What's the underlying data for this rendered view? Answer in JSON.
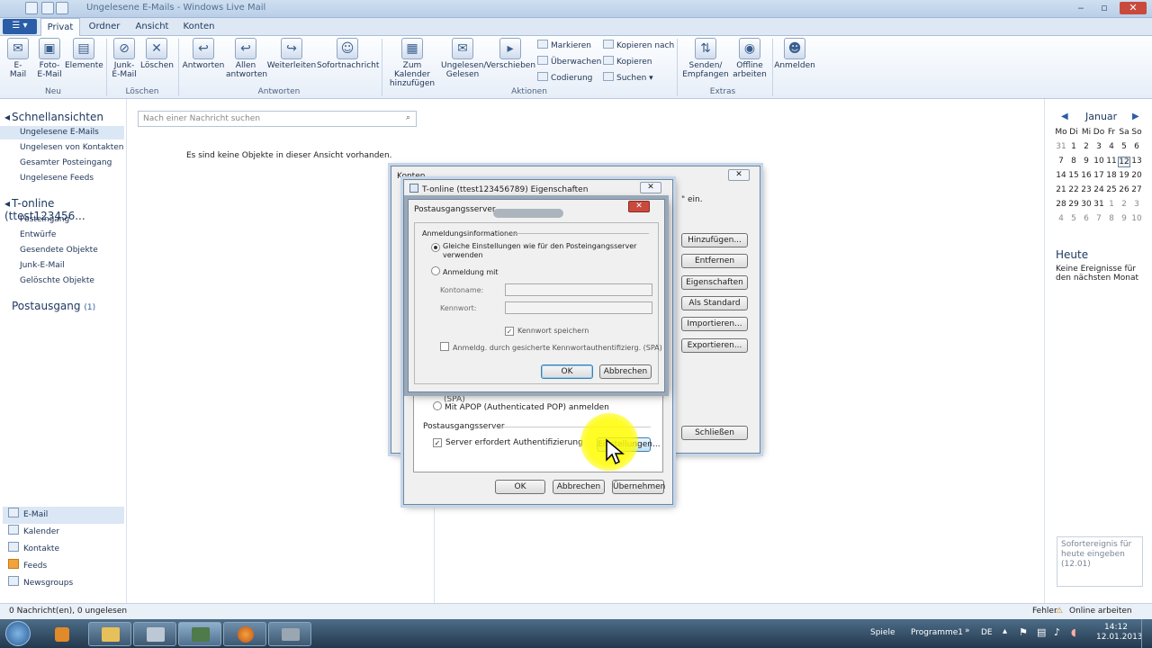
{
  "window": {
    "title": "Ungelesene E-Mails - Windows Live Mail"
  },
  "tabs": {
    "file": "☰ ▾",
    "items": [
      "Privat",
      "Ordner",
      "Ansicht",
      "Konten"
    ]
  },
  "ribbon": {
    "new": {
      "email": "E-Mail",
      "photo": "Foto-E-Mail",
      "items": "Elemente",
      "group": "Neu"
    },
    "delete": {
      "junk": "Junk-E-Mail",
      "delete": "Löschen",
      "group": "Löschen"
    },
    "respond": {
      "reply": "Antworten",
      "reply_all": "Allen antworten",
      "forward": "Weiterleiten",
      "im": "Sofortnachricht",
      "group": "Antworten"
    },
    "actions": {
      "calendar": "Zum Kalender hinzufügen",
      "unread": "Ungelesen/ Gelesen",
      "move": "Verschieben",
      "flag": "Markieren",
      "watch": "Überwachen",
      "encoding": "Codierung",
      "copy_to": "Kopieren nach",
      "copy": "Kopieren",
      "find": "Suchen",
      "group": "Aktionen"
    },
    "tools": {
      "sendrecv": "Senden/ Empfangen",
      "offline": "Offline arbeiten",
      "signin": "Anmelden",
      "group": "Extras"
    }
  },
  "nav": {
    "quick_views": "Schnellansichten",
    "quick_items": [
      "Ungelesene E-Mails",
      "Ungelesen von Kontakten",
      "Gesamter Posteingang",
      "Ungelesene Feeds"
    ],
    "account": "T-online (ttest123456...",
    "account_items": [
      "Posteingang",
      "Entwürfe",
      "Gesendete Objekte",
      "Junk-E-Mail",
      "Gelöschte Objekte"
    ],
    "outbox": "Postausgang",
    "outbox_count": "(1)",
    "bottom": [
      "E-Mail",
      "Kalender",
      "Kontakte",
      "Feeds",
      "Newsgroups"
    ]
  },
  "search": {
    "placeholder": "Nach einer Nachricht suchen"
  },
  "empty_message": "Es sind keine Objekte in dieser Ansicht vorhanden.",
  "calendar": {
    "month": "Januar",
    "weekdays": [
      "Mo",
      "Di",
      "Mi",
      "Do",
      "Fr",
      "Sa",
      "So"
    ],
    "rows": [
      [
        "31",
        "1",
        "2",
        "3",
        "4",
        "5",
        "6"
      ],
      [
        "7",
        "8",
        "9",
        "10",
        "11",
        "12",
        "13"
      ],
      [
        "14",
        "15",
        "16",
        "17",
        "18",
        "19",
        "20"
      ],
      [
        "21",
        "22",
        "23",
        "24",
        "25",
        "26",
        "27"
      ],
      [
        "28",
        "29",
        "30",
        "31",
        "1",
        "2",
        "3"
      ],
      [
        "4",
        "5",
        "6",
        "7",
        "8",
        "9",
        "10"
      ]
    ],
    "today_heading": "Heute",
    "no_events": "Keine Ereignisse für den nächsten Monat",
    "quick_event": "Sofortereignis für heute eingeben (12.01)"
  },
  "status": {
    "left": "0 Nachricht(en), 0 ungelesen",
    "errors": "Fehler",
    "online": "Online arbeiten"
  },
  "accounts_dialog": {
    "title": "Konten",
    "hint": "\" ein.",
    "buttons": [
      "Hinzufügen...",
      "Entfernen",
      "Eigenschaften",
      "Als Standard",
      "Importieren...",
      "Exportieren..."
    ],
    "close": "Schließen"
  },
  "props_dialog": {
    "title": "T-online (ttest123456789) Eigenschaften",
    "spa_text": "Anmeldg. durch gesicherte Kennwortauthentifizierg. (SPA)",
    "apop": "Mit APOP (Authenticated POP) anmelden",
    "outgoing_group": "Postausgangsserver",
    "auth_required": "Server erfordert Authentifizierung",
    "settings": "Einstellungen...",
    "ok": "OK",
    "cancel": "Abbrechen",
    "apply": "Übernehmen"
  },
  "smtp_dialog": {
    "title": "Postausgangsserver",
    "group": "Anmeldungsinformationen",
    "same_settings": "Gleiche Einstellungen wie für den Posteingangsserver verwenden",
    "login_with": "Anmeldung mit",
    "account_label": "Kontoname:",
    "password_label": "Kennwort:",
    "save_password": "Kennwort speichern",
    "spa": "Anmeldg. durch gesicherte Kennwortauthentifizierg. (SPA)",
    "ok": "OK",
    "cancel": "Abbrechen"
  },
  "taskbar": {
    "games": "Spiele",
    "programs": "Programme1",
    "lang": "DE",
    "time": "14:12",
    "date": "12.01.2013"
  }
}
